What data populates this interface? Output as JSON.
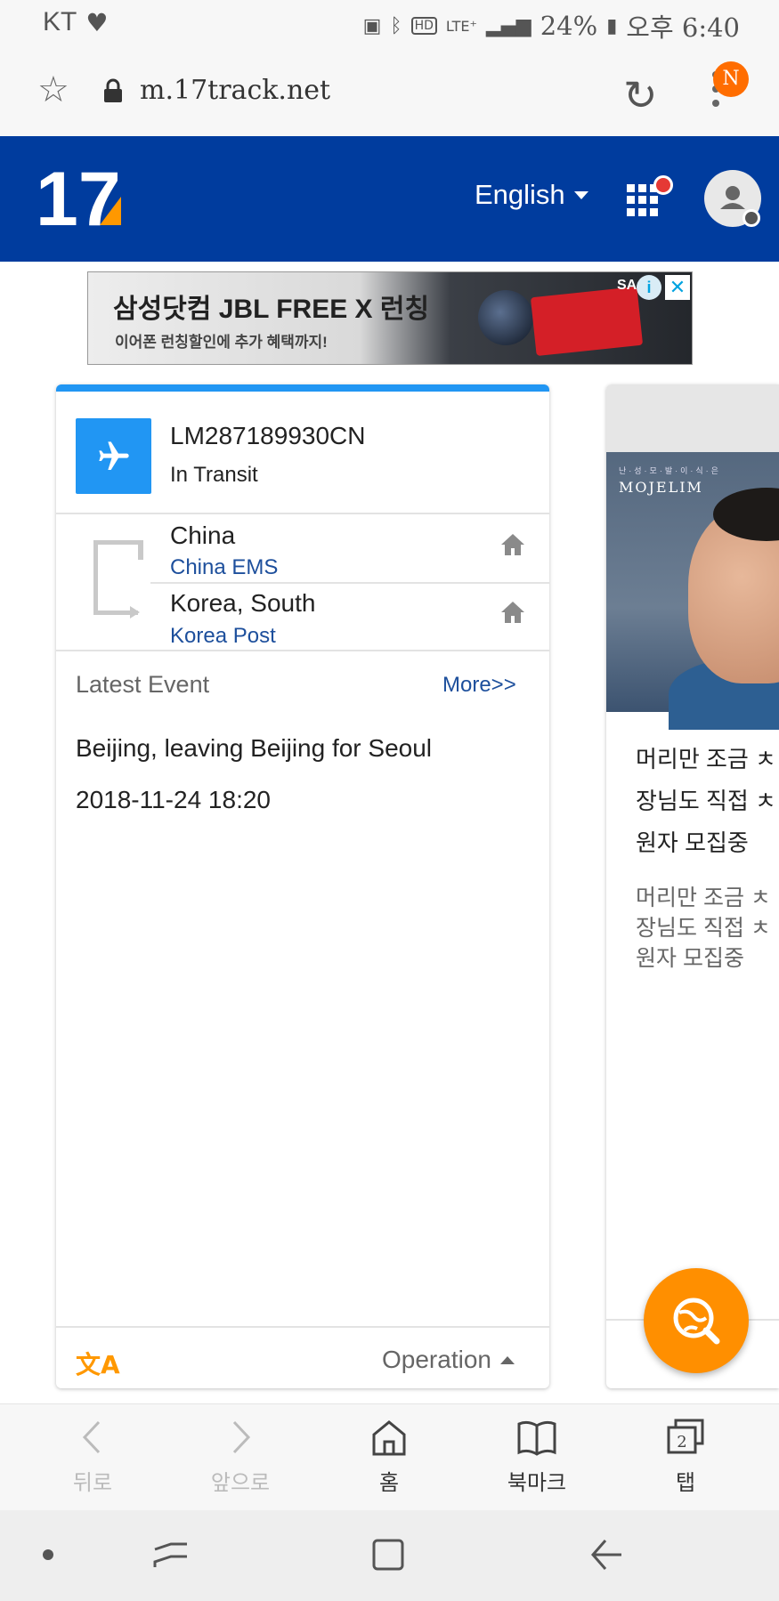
{
  "status_bar": {
    "carrier": "KT",
    "battery": "24%",
    "time": "오후 6:40",
    "icons": [
      "heart-icon",
      "battery-saver-icon",
      "bluetooth-icon",
      "hd-icon",
      "lte-icon",
      "signal-icon",
      "battery-icon"
    ]
  },
  "browser": {
    "url": "m.17track.net",
    "notification_badge": "N"
  },
  "header": {
    "logo_text": "17",
    "language": "English",
    "colors": {
      "header_bg": "#003c9e",
      "logo_accent": "#ff9800"
    }
  },
  "ad_banner": {
    "headline": "삼성닷컴 JBL FREE X 런칭",
    "subline": "이어폰 런칭할인에 추가 혜택까지!",
    "brand": "SA",
    "info_label": "i",
    "close_label": "✕"
  },
  "tracking": {
    "number": "LM287189930CN",
    "status": "In Transit",
    "origin": {
      "country": "China",
      "carrier": "China EMS"
    },
    "destination": {
      "country": "Korea, South",
      "carrier": "Korea Post"
    },
    "latest_event_label": "Latest Event",
    "more_link": "More>>",
    "event_description": "Beijing, leaving Beijing for Seoul",
    "event_time": "2018-11-24 18:20",
    "operation_label": "Operation",
    "colors": {
      "accent": "#2196f3",
      "link": "#1d4f9c",
      "translate": "#ff9800"
    }
  },
  "side_ad": {
    "brand_small": "난·성·모·발·이·식·은",
    "brand": "MOJELIM",
    "title": "머리만 조금 ㅊ\n장님도 직접 ㅊ\n원자 모집중",
    "description": "머리만 조금 ㅊ\n장님도 직접 ㅊ\n원자 모집중"
  },
  "fab": {
    "icon": "search-globe-icon",
    "color": "#ff8f00"
  },
  "browser_nav": {
    "back": "뒤로",
    "forward": "앞으로",
    "home": "홈",
    "bookmarks": "북마크",
    "tabs": "탭",
    "tab_count": "2"
  }
}
